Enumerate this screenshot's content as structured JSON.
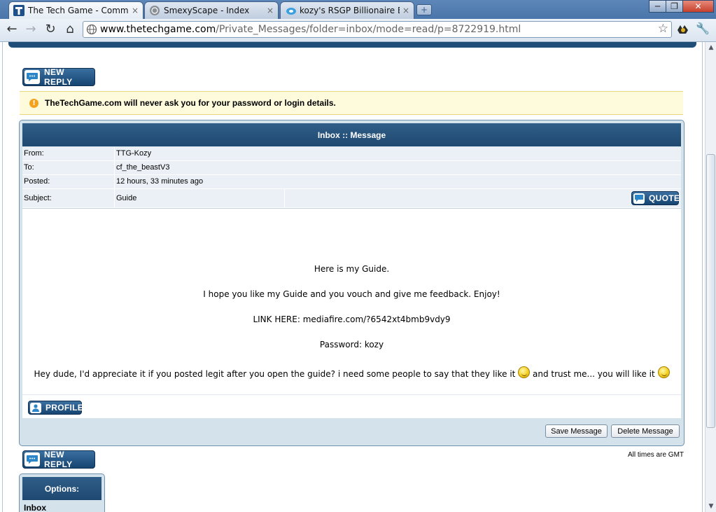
{
  "browser": {
    "tabs": [
      {
        "label": "The Tech Game - Community",
        "close": "×",
        "icon": "ttg-favicon"
      },
      {
        "label": "SmexyScape - Index",
        "close": "×",
        "icon": "globe-favicon"
      },
      {
        "label": "kozy's RSGP Billionaire Ebook.p",
        "close": "×",
        "icon": "mediafire-favicon"
      }
    ],
    "new_tab": "+",
    "window_controls": {
      "minimize": "─",
      "maximize": "❐",
      "close": "✕"
    },
    "nav": {
      "back": "←",
      "forward": "→",
      "reload": "↻",
      "home": "⌂"
    },
    "url_host": "www.thetechgame.com",
    "url_path": "/Private_Messages/folder=inbox/mode=read/p=8722919.html",
    "bookmark_star": "☆",
    "wrench": "🔧"
  },
  "page": {
    "new_reply_label": "New Reply",
    "notice": {
      "icon": "!",
      "text": "TheTechGame.com will never ask you for your password or login details."
    },
    "message": {
      "header": "Inbox :: Message",
      "from_label": "From:",
      "from_value": "TTG-Kozy",
      "to_label": "To:",
      "to_value": "cf_the_beastV3",
      "posted_label": "Posted:",
      "posted_value": "12 hours, 33 minutes ago",
      "subject_label": "Subject:",
      "subject_value": "Guide",
      "quote_label": "Quote",
      "body": {
        "line1": "Here is my Guide.",
        "line2": "I hope you like my Guide and you vouch and give me feedback. Enjoy!",
        "line3": "LINK HERE: mediafire.com/?6542xt4bmb9vdy9",
        "line4": "Password: kozy",
        "line5a": "Hey dude, I'd appreciate it if you posted legit after you open the guide? i need some people to say that they like it",
        "line5b": "and trust me... you will like it"
      },
      "profile_label": "Profile",
      "save_label": "Save Message",
      "delete_label": "Delete Message"
    },
    "timezone": "All times are GMT",
    "options": {
      "header": "Options:",
      "inbox": "Inbox"
    }
  },
  "colors": {
    "accent": "#1f4870",
    "notice_bg": "#fdfbdc",
    "panel_bg": "#d4e2ec"
  }
}
